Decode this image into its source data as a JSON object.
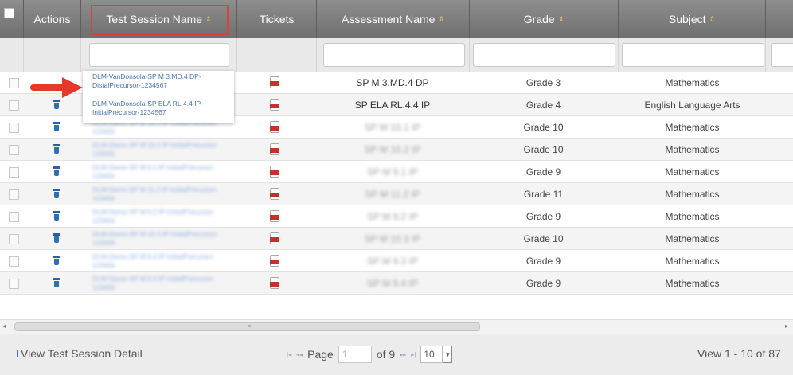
{
  "columns": {
    "actions": "Actions",
    "session": "Test Session Name",
    "tickets": "Tickets",
    "assessment": "Assessment Name",
    "grade": "Grade",
    "subject": "Subject"
  },
  "sort_glyph": "⇕",
  "rows": [
    {
      "session": "DLM-VanDonsola-SP M 3.MD.4 DP-DistalPrecursor-1234567",
      "assessment": "SP M 3.MD.4 DP",
      "grade": "Grade 3",
      "subject": "Mathematics",
      "has_trash": false
    },
    {
      "session": "DLM-VanDonsola-SP ELA RL.4.4 IP-InitialPrecursor-1234567",
      "assessment": "SP ELA RL.4.4 IP",
      "grade": "Grade 4",
      "subject": "English Language Arts",
      "has_trash": true
    },
    {
      "session": "DLM-Demo-SP M 10.1 IP-InitialPrecursor-123456",
      "assessment": "SP M 10.1 IP",
      "grade": "Grade 10",
      "subject": "Mathematics",
      "has_trash": true
    },
    {
      "session": "DLM-Demo-SP M 10.2 IP-InitialPrecursor-123456",
      "assessment": "SP M 10.2 IP",
      "grade": "Grade 10",
      "subject": "Mathematics",
      "has_trash": true
    },
    {
      "session": "DLM-Demo-SP M 9.1 IP-InitialPrecursor-123456",
      "assessment": "SP M 9.1 IP",
      "grade": "Grade 9",
      "subject": "Mathematics",
      "has_trash": true
    },
    {
      "session": "DLM-Demo-SP M 11.2 IP-InitialPrecursor-123456",
      "assessment": "SP M 11.2 IP",
      "grade": "Grade 11",
      "subject": "Mathematics",
      "has_trash": true
    },
    {
      "session": "DLM-Demo-SP M 9.2 IP-InitialPrecursor-123456",
      "assessment": "SP M 9.2 IP",
      "grade": "Grade 9",
      "subject": "Mathematics",
      "has_trash": true
    },
    {
      "session": "DLM-Demo-SP M 10.3 IP-InitialPrecursor-123456",
      "assessment": "SP M 10.3 IP",
      "grade": "Grade 10",
      "subject": "Mathematics",
      "has_trash": true
    },
    {
      "session": "DLM-Demo-SP M 9.3 IP-InitialPrecursor-123456",
      "assessment": "SP M 9.3 IP",
      "grade": "Grade 9",
      "subject": "Mathematics",
      "has_trash": true
    },
    {
      "session": "DLM-Demo-SP M 9.4 IP-InitialPrecursor-123456",
      "assessment": "SP M 9.4 IP",
      "grade": "Grade 9",
      "subject": "Mathematics",
      "has_trash": true
    }
  ],
  "popup": {
    "line1": "DLM-VanDonsola-SP M 3.MD.4 DP-DistalPrecursor-1234567",
    "line2": "DLM-VanDonsola-SP ELA RL.4.4 IP-InitialPrecursor-1234567"
  },
  "pager": {
    "view_detail": "View Test Session Detail",
    "page_label": "Page",
    "page_value": "1",
    "of_label": "of 9",
    "rows_per_page": "10",
    "range": "View 1 - 10 of 87"
  },
  "colors": {
    "header_bg": "#7f7f7f",
    "highlight_border": "#d9433a",
    "arrow": "#e5392b",
    "link": "#4773b8"
  },
  "icons": {
    "trash": "trash-icon",
    "pdf": "pdf-icon",
    "arrow": "red-arrow-icon"
  }
}
